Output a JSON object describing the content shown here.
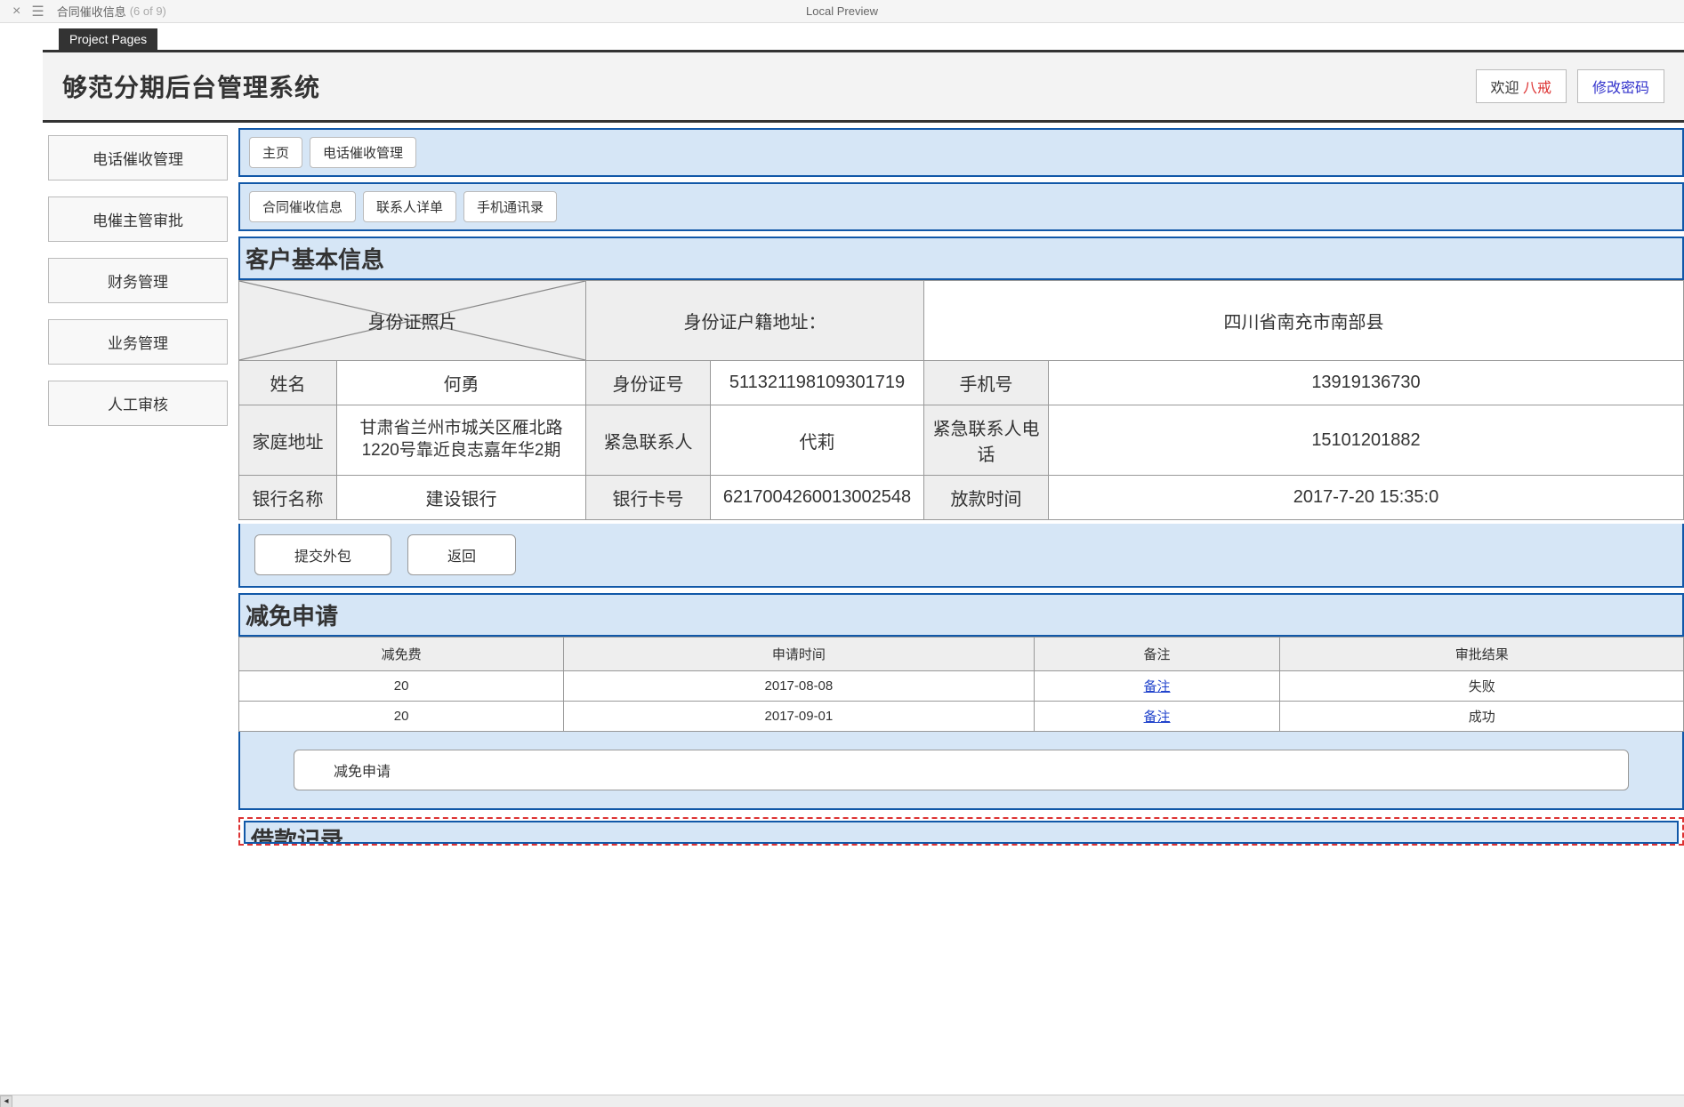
{
  "toolbar": {
    "tab_title": "合同催收信息",
    "tab_count": "(6 of 9)",
    "center_label": "Local Preview"
  },
  "project_pages_badge": "Project Pages",
  "header": {
    "title": "够范分期后台管理系统",
    "welcome_prefix": "欢迎",
    "welcome_user": "八戒",
    "change_pwd": "修改密码"
  },
  "sidebar": {
    "items": [
      {
        "label": "电话催收管理"
      },
      {
        "label": "电催主管审批"
      },
      {
        "label": "财务管理"
      },
      {
        "label": "业务管理"
      },
      {
        "label": "人工审核"
      }
    ]
  },
  "crumbs1": [
    {
      "label": "主页"
    },
    {
      "label": "电话催收管理"
    }
  ],
  "crumbs2": [
    {
      "label": "合同催收信息"
    },
    {
      "label": "联系人详单"
    },
    {
      "label": "手机通讯录"
    }
  ],
  "section_customer": "客户基本信息",
  "info": {
    "id_photo_label": "身份证照片",
    "hukou_addr_label": "身份证户籍地址：",
    "hukou_addr_value": "四川省南充市南部县",
    "name_label": "姓名",
    "name_value": "何勇",
    "id_no_label": "身份证号",
    "id_no_value": "511321198109301719",
    "phone_label": "手机号",
    "phone_value": "13919136730",
    "home_addr_label": "家庭地址",
    "home_addr_value": "甘肃省兰州市城关区雁北路1220号靠近良志嘉年华2期",
    "emergency_contact_label": "紧急联系人",
    "emergency_contact_value": "代莉",
    "emergency_phone_label": "紧急联系人电话",
    "emergency_phone_value": "15101201882",
    "bank_name_label": "银行名称",
    "bank_name_value": "建设银行",
    "bank_no_label": "银行卡号",
    "bank_no_value": "6217004260013002548",
    "disburse_time_label": "放款时间",
    "disburse_time_value": "2017-7-20 15:35:0"
  },
  "actions": {
    "submit_outsource": "提交外包",
    "back": "返回"
  },
  "section_reduce": "减免申请",
  "reduce_table": {
    "headers": [
      "减免费",
      "申请时间",
      "备注",
      "审批结果"
    ],
    "rows": [
      {
        "fee": "20",
        "date": "2017-08-08",
        "note": "备注",
        "result": "失败"
      },
      {
        "fee": "20",
        "date": "2017-09-01",
        "note": "备注",
        "result": "成功"
      }
    ]
  },
  "reduce_action": "减免申请",
  "section_loan": "借款记录"
}
